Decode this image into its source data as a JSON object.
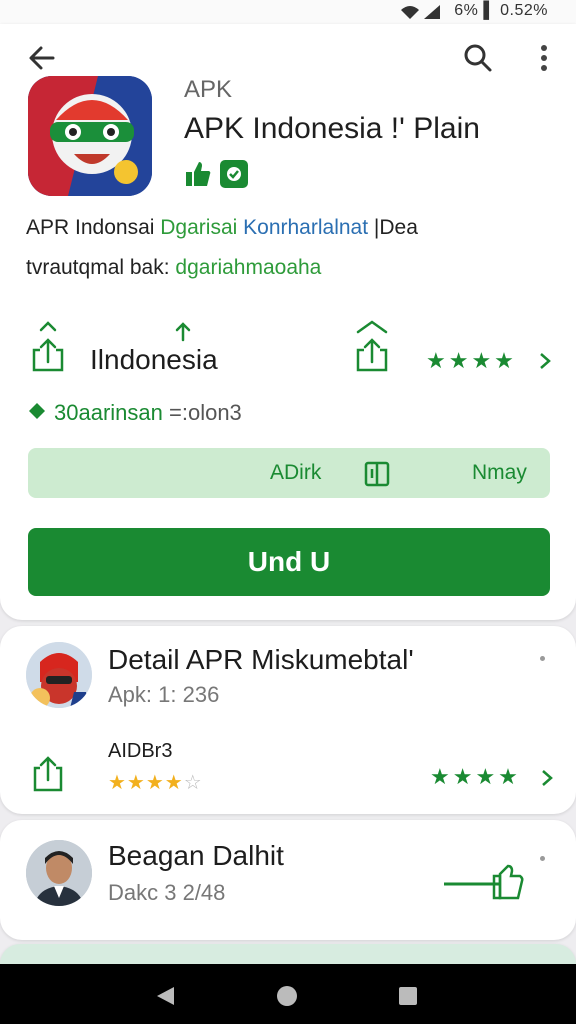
{
  "status_bar": {
    "text": "6% ▌ 0.52%"
  },
  "header": {
    "back_icon": "arrow-left-icon",
    "search_icon": "search-icon",
    "menu_icon": "more-vertical-icon"
  },
  "app": {
    "subtitle": "APK",
    "title": "APK Indonesia !' Plain",
    "desc_line1_a": "APR Indonsai",
    "desc_line1_b": "Dgarisai",
    "desc_line1_c": "Konrharlalnat",
    "desc_line1_d": "|Dea",
    "desc_line2_a": "tvrautqmal bak:",
    "desc_line2_b": "dgariahmaoaha",
    "region": "Ilndonesia",
    "stars": "★★★★",
    "downloads": "30aarinsan",
    "downloads_meta": "=:olon3",
    "secondary_left": "ADirk",
    "secondary_right": "Nmay",
    "install_label": "Und U"
  },
  "items": [
    {
      "title": "Detail APR Miskumebtal'",
      "subtitle": "Apk: 1: 236",
      "label": "AIDBr3",
      "stars_rating": "★★★★",
      "stars_empty": "☆",
      "stars_right": "★★★★"
    },
    {
      "title": "Beagan Dalhit",
      "subtitle": "Dakc 3 2/48"
    }
  ],
  "colors": {
    "accent": "#1a8a32",
    "light_accent": "#cdebd0",
    "link_green": "#2e9b3a",
    "link_blue": "#2b6fb2"
  }
}
